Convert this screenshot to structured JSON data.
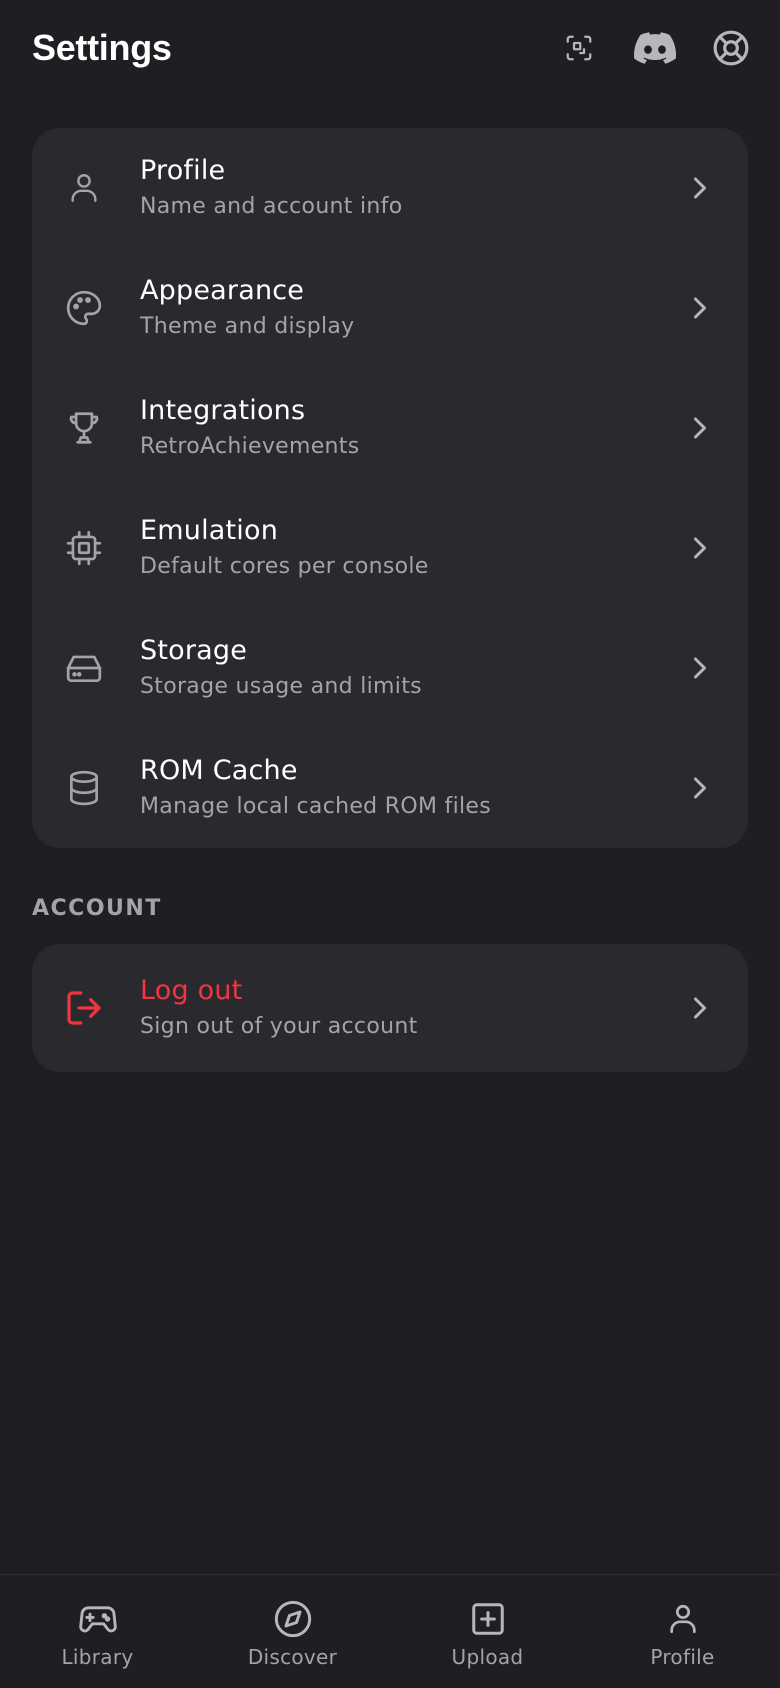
{
  "header": {
    "title": "Settings",
    "actions": [
      {
        "icon": "qr-scan-icon"
      },
      {
        "icon": "discord-icon"
      },
      {
        "icon": "lifebuoy-icon"
      }
    ]
  },
  "settings": {
    "items": [
      {
        "title": "Profile",
        "subtitle": "Name and account info",
        "icon": "user-icon"
      },
      {
        "title": "Appearance",
        "subtitle": "Theme and display",
        "icon": "palette-icon"
      },
      {
        "title": "Integrations",
        "subtitle": "RetroAchievements",
        "icon": "trophy-icon"
      },
      {
        "title": "Emulation",
        "subtitle": "Default cores per console",
        "icon": "cpu-chip-icon"
      },
      {
        "title": "Storage",
        "subtitle": "Storage usage and limits",
        "icon": "hard-drive-icon"
      },
      {
        "title": "ROM Cache",
        "subtitle": "Manage local cached ROM files",
        "icon": "database-icon"
      }
    ]
  },
  "account": {
    "section_label": "ACCOUNT",
    "logout": {
      "title": "Log out",
      "subtitle": "Sign out of your account",
      "icon": "logout-icon"
    }
  },
  "bottom_nav": {
    "items": [
      {
        "label": "Library",
        "icon": "gamepad-icon"
      },
      {
        "label": "Discover",
        "icon": "compass-icon"
      },
      {
        "label": "Upload",
        "icon": "plus-square-icon"
      },
      {
        "label": "Profile",
        "icon": "user-icon"
      }
    ]
  },
  "colors": {
    "background": "#1f1e23",
    "card": "#2a292e",
    "text_primary": "#ffffff",
    "text_secondary": "#a4a3a9",
    "danger": "#f0363f"
  }
}
